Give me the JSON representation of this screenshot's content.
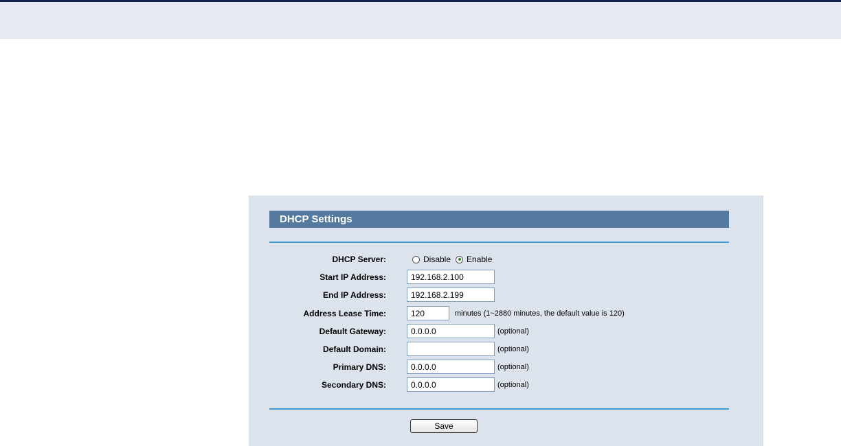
{
  "panel": {
    "title": "DHCP Settings"
  },
  "dhcp_server": {
    "label": "DHCP Server:",
    "options": [
      "Disable",
      "Enable"
    ],
    "selected": "Enable"
  },
  "fields": {
    "start_ip": {
      "label": "Start IP Address:",
      "value": "192.168.2.100"
    },
    "end_ip": {
      "label": "End IP Address:",
      "value": "192.168.2.199"
    },
    "lease_time": {
      "label": "Address Lease Time:",
      "value": "120",
      "hint": "minutes (1~2880 minutes, the default value is 120)"
    },
    "default_gateway": {
      "label": "Default Gateway:",
      "value": "0.0.0.0",
      "hint": "(optional)"
    },
    "default_domain": {
      "label": "Default Domain:",
      "value": "",
      "hint": "(optional)"
    },
    "primary_dns": {
      "label": "Primary DNS:",
      "value": "0.0.0.0",
      "hint": "(optional)"
    },
    "secondary_dns": {
      "label": "Secondary DNS:",
      "value": "0.0.0.0",
      "hint": "(optional)"
    }
  },
  "actions": {
    "save_label": "Save"
  },
  "colors": {
    "title_bar": "#557aa0",
    "panel_bg": "#dde3ec",
    "rule": "#3b9ed2",
    "header_band": "#e6e9f1",
    "top_line": "#13254f"
  }
}
